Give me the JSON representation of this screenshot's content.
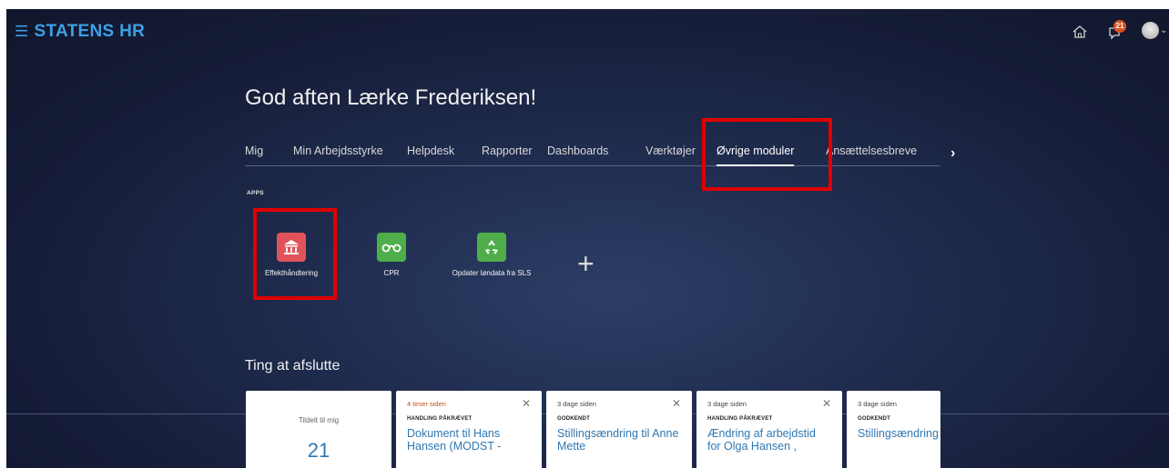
{
  "app": {
    "title": "STATENS HR",
    "menu_icon": "hamburger-icon"
  },
  "topbar": {
    "home_icon": "home-icon",
    "notification_icon": "notification-icon",
    "notification_count": "21",
    "avatar": "user-avatar"
  },
  "greeting": "God aften Lærke Frederiksen!",
  "tabs": [
    {
      "label": "Mig"
    },
    {
      "label": "Min Arbejdsstyrke"
    },
    {
      "label": "Helpdesk"
    },
    {
      "label": "Rapporter"
    },
    {
      "label": "Dashboards"
    },
    {
      "label": "Værktøjer"
    },
    {
      "label": "Øvrige moduler",
      "active": true
    },
    {
      "label": "Ansættelsesbreve"
    }
  ],
  "tabs_next_icon": "chevron-right-icon",
  "apps_section": {
    "title": "APPS",
    "items": [
      {
        "label": "Effekthåndtering",
        "icon": "bank-building-icon",
        "color": "#e0535b"
      },
      {
        "label": "CPR",
        "icon": "eye-linked-icon",
        "color": "#4fae49"
      },
      {
        "label": "Opdater løndata fra SLS",
        "icon": "recycle-icon",
        "color": "#4fae49"
      }
    ],
    "add_icon": "plus-icon"
  },
  "ting_section": {
    "title": "Ting at afslutte",
    "summary": {
      "label": "Tildelt til mig",
      "count": "21"
    },
    "cards": [
      {
        "time": "4 timer siden",
        "status": "HANDLING PÅKRÆVET",
        "title": "Dokument til Hans Hansen (MODST -"
      },
      {
        "time": "3 dage siden",
        "status": "GODKENDT",
        "title": "Stillingsændring til Anne Mette"
      },
      {
        "time": "3 dage siden",
        "status": "HANDLING PÅKRÆVET",
        "title": "Ændring af arbejdstid for Olga Hansen ,"
      },
      {
        "time": "3 dage siden",
        "status": "GODKENDT",
        "title": "Stillingsændring Anne Mette"
      }
    ]
  },
  "colors": {
    "brand": "#3da0e6",
    "highlight": "#e00000",
    "link": "#2f77b1",
    "urgent": "#c7501a"
  }
}
